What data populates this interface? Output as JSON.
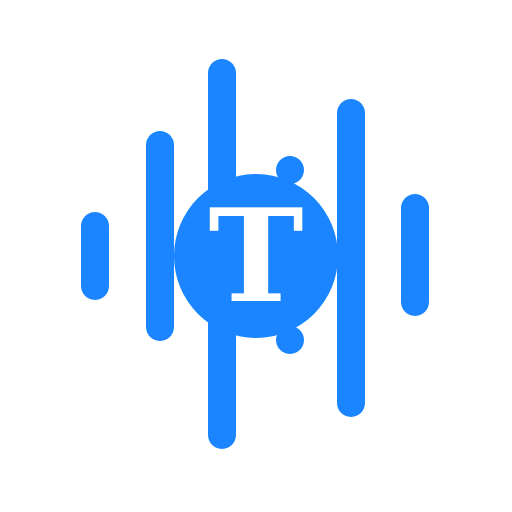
{
  "logo": {
    "letter": "T",
    "accent_color": "#1a85ff",
    "letter_color": "#ffffff",
    "background_color": "#ffffff"
  }
}
